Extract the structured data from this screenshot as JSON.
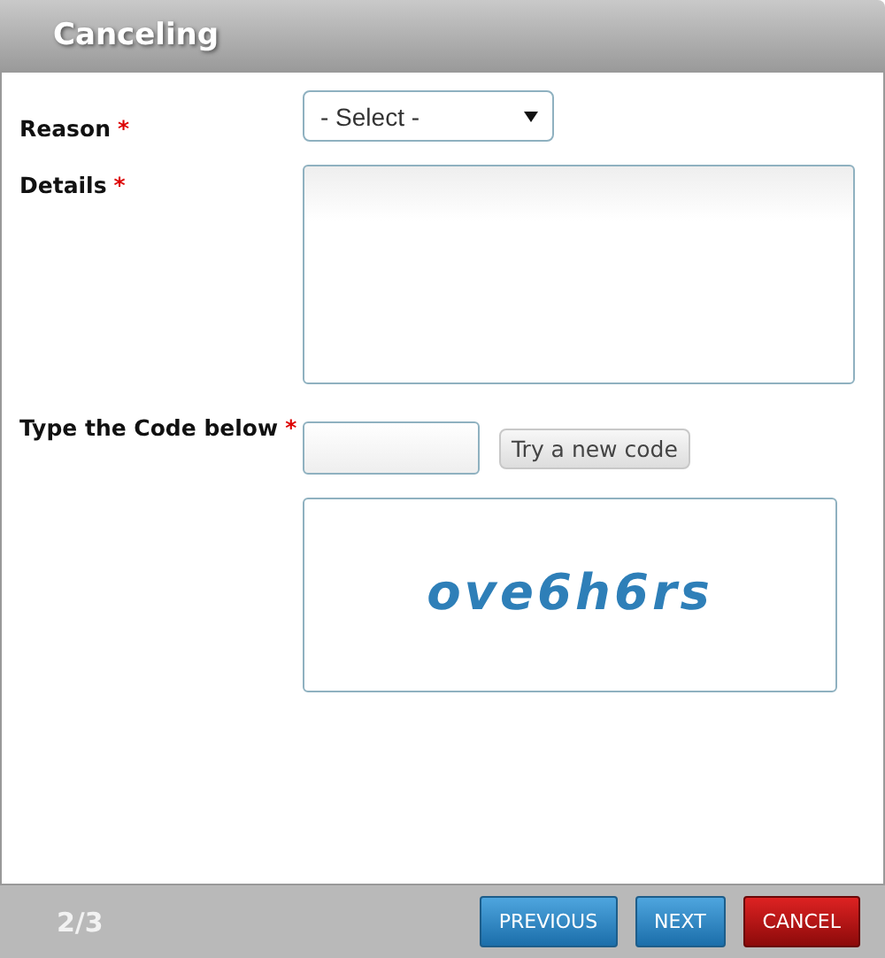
{
  "window": {
    "title": "Canceling"
  },
  "fields": [
    {
      "kind": "select",
      "label": "Reason",
      "required_mark": "*",
      "value": "- Select -"
    },
    {
      "kind": "textarea",
      "label": "Details",
      "required_mark": "*"
    },
    {
      "kind": "captcha",
      "label": "Type the Code below",
      "required_mark": "*",
      "refresh_button": "Try a new code",
      "captcha_text": "ove6h6rs"
    }
  ],
  "footer": {
    "step": "2/3",
    "buttons": [
      {
        "label": "PREVIOUS",
        "kind": "primary"
      },
      {
        "label": "NEXT",
        "kind": "primary"
      },
      {
        "label": "CANCEL",
        "kind": "danger"
      }
    ]
  }
}
